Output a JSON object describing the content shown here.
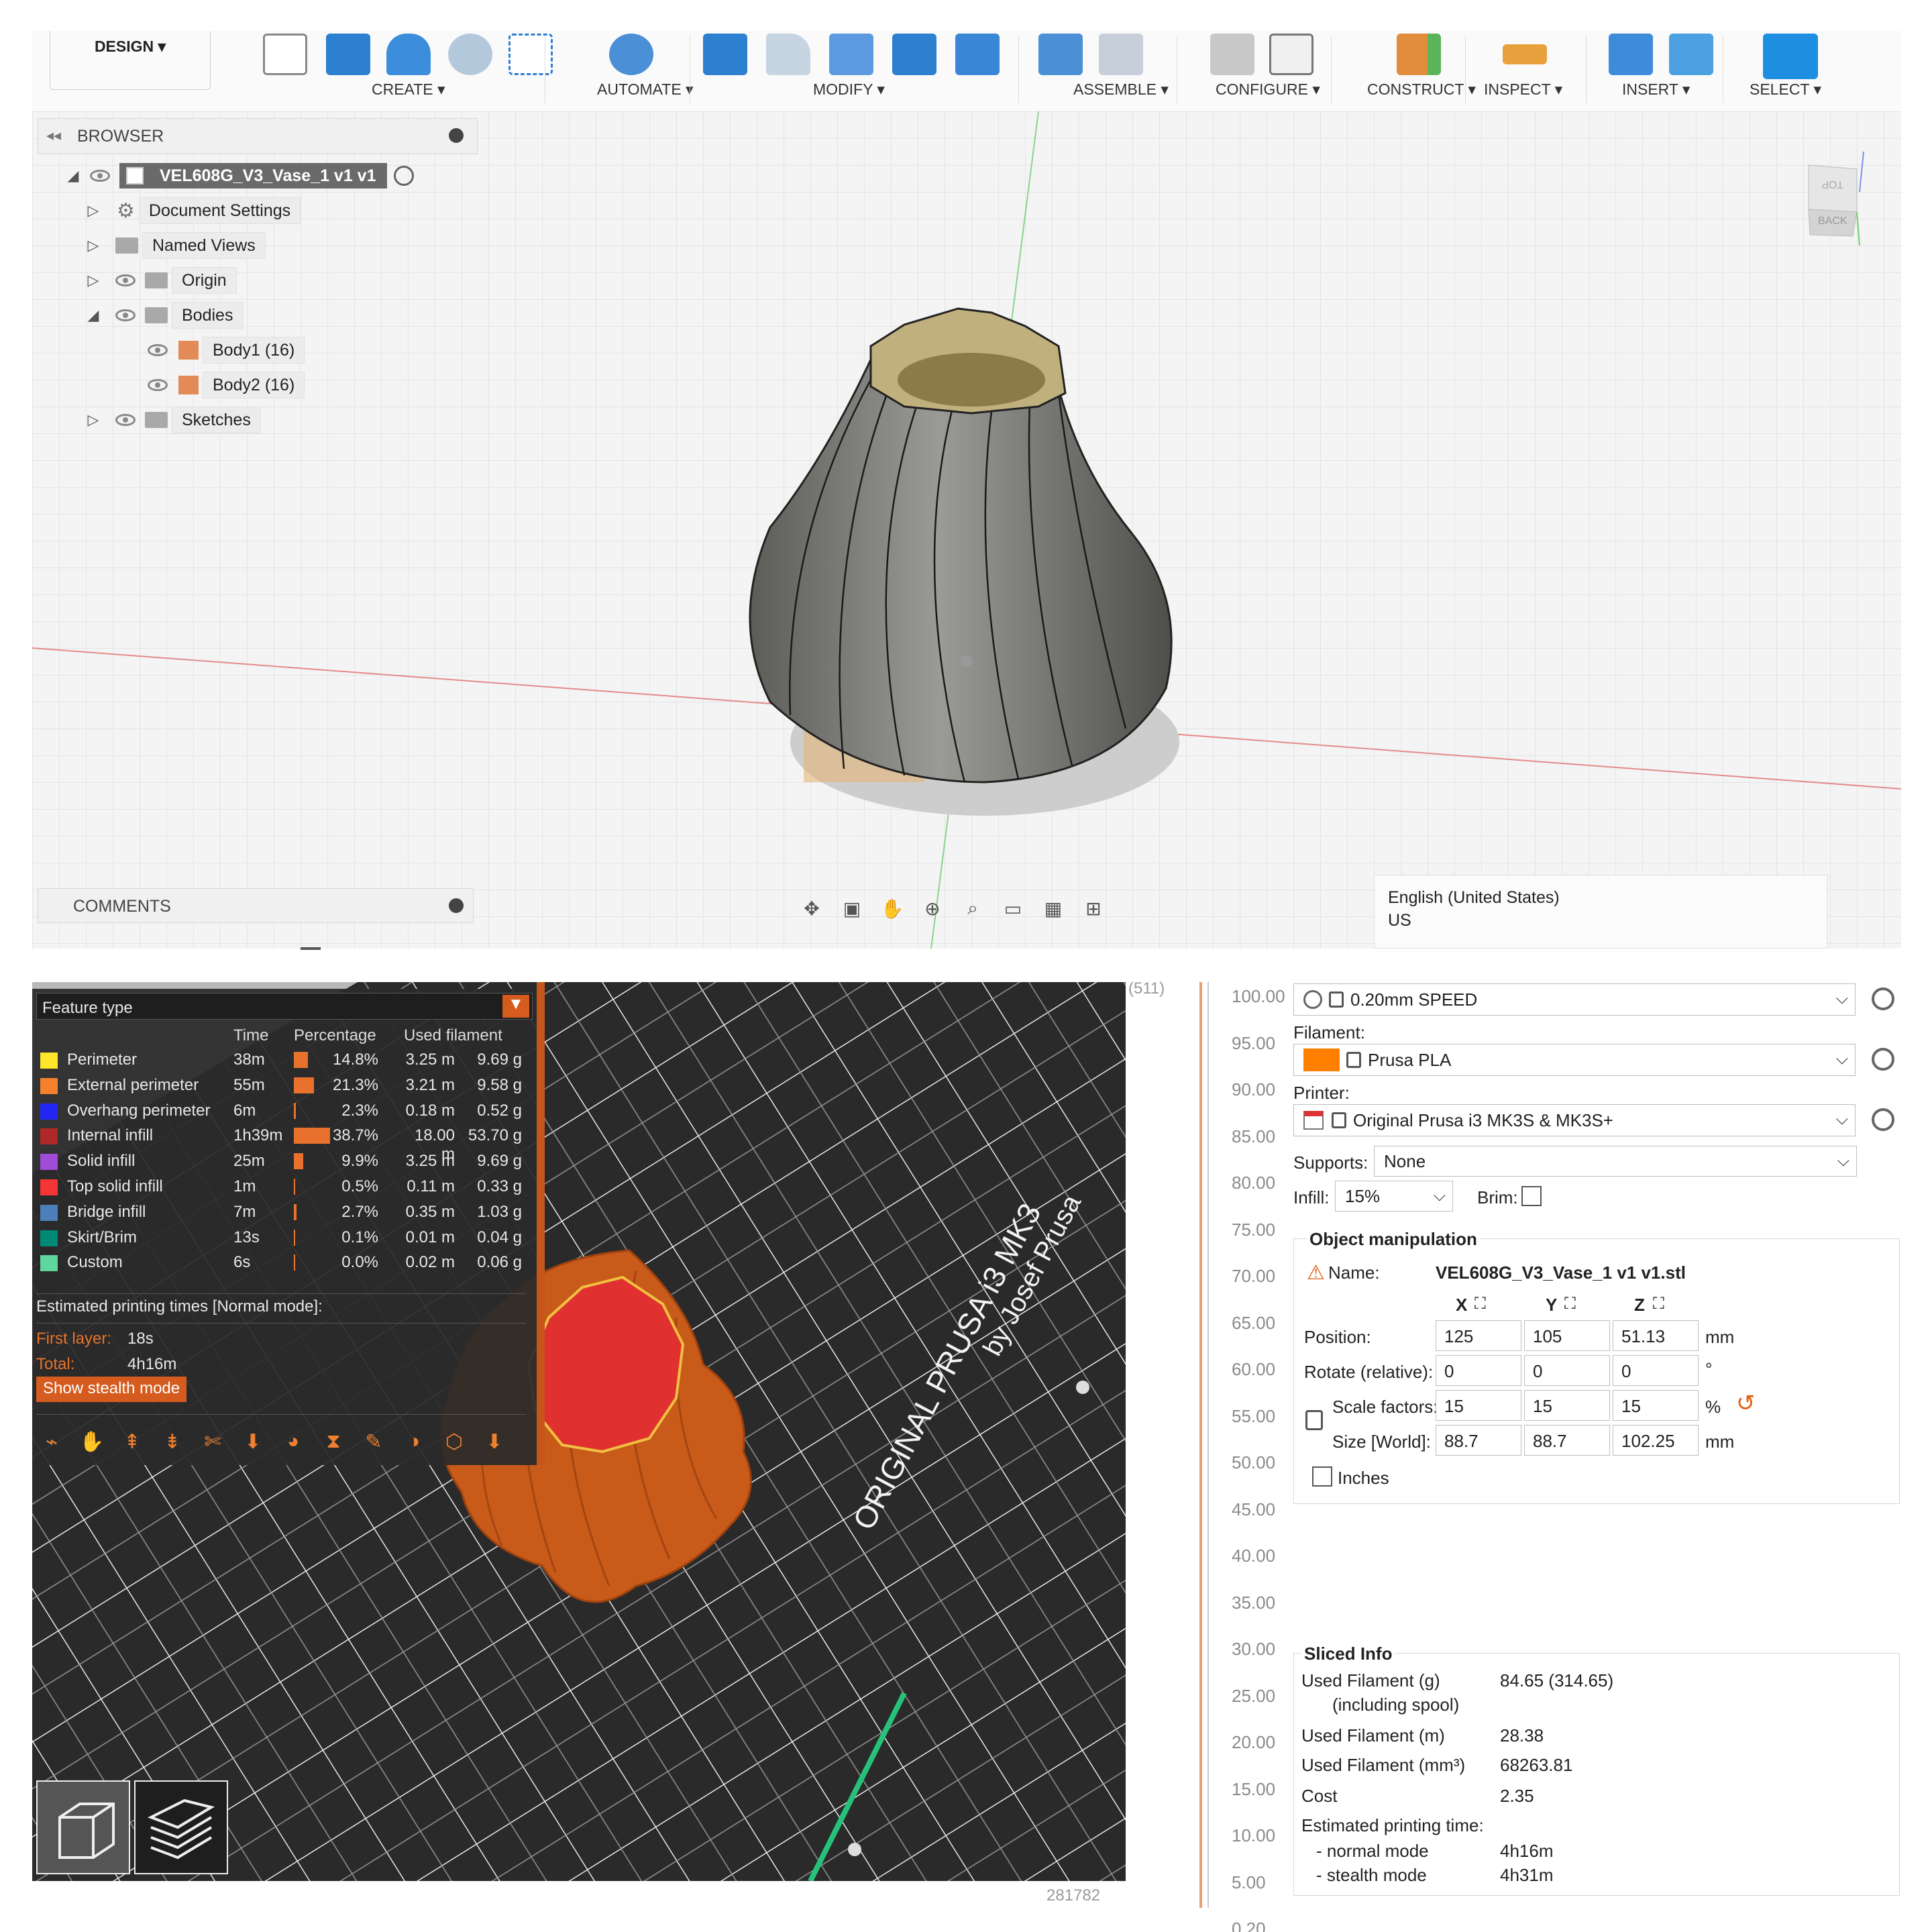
{
  "fusion": {
    "workspace": "DESIGN ▾",
    "toolbar_groups": [
      {
        "label": "CREATE ▾"
      },
      {
        "label": "AUTOMATE ▾"
      },
      {
        "label": "MODIFY ▾"
      },
      {
        "label": "ASSEMBLE ▾"
      },
      {
        "label": "CONFIGURE ▾"
      },
      {
        "label": "CONSTRUCT ▾"
      },
      {
        "label": "INSPECT ▾"
      },
      {
        "label": "INSERT ▾"
      },
      {
        "label": "SELECT ▾"
      }
    ],
    "browser": {
      "title": "BROWSER",
      "root": "VEL608G_V3_Vase_1 v1 v1",
      "items": [
        {
          "label": "Document Settings"
        },
        {
          "label": "Named Views"
        },
        {
          "label": "Origin"
        },
        {
          "label": "Bodies"
        },
        {
          "label": "Body1 (16)"
        },
        {
          "label": "Body2 (16)"
        },
        {
          "label": "Sketches"
        }
      ]
    },
    "comments": "COMMENTS",
    "view_cube": {
      "top": "TOP",
      "back": "BACK"
    },
    "language_tip": {
      "line1": "English (United States)",
      "line2": "US"
    }
  },
  "prusa": {
    "legend": {
      "title": "Feature type",
      "headers": {
        "time": "Time",
        "percentage": "Percentage",
        "used": "Used filament"
      },
      "rows": [
        {
          "name": "Perimeter",
          "color": "#ffe628",
          "time": "38m",
          "pct": "14.8%",
          "pct_val": 14.8,
          "m": "3.25 m",
          "g": "9.69 g"
        },
        {
          "name": "External perimeter",
          "color": "#f5812f",
          "time": "55m",
          "pct": "21.3%",
          "pct_val": 21.3,
          "m": "3.21 m",
          "g": "9.58 g"
        },
        {
          "name": "Overhang perimeter",
          "color": "#2226f5",
          "time": "6m",
          "pct": "2.3%",
          "pct_val": 2.3,
          "m": "0.18 m",
          "g": "0.52 g"
        },
        {
          "name": "Internal infill",
          "color": "#b02828",
          "time": "1h39m",
          "pct": "38.7%",
          "pct_val": 38.7,
          "m": "18.00 m",
          "g": "53.70 g"
        },
        {
          "name": "Solid infill",
          "color": "#a04cd9",
          "time": "25m",
          "pct": "9.9%",
          "pct_val": 9.9,
          "m": "3.25 m",
          "g": "9.69 g"
        },
        {
          "name": "Top solid infill",
          "color": "#f53535",
          "time": "1m",
          "pct": "0.5%",
          "pct_val": 0.5,
          "m": "0.11 m",
          "g": "0.33 g"
        },
        {
          "name": "Bridge infill",
          "color": "#4d80ba",
          "time": "7m",
          "pct": "2.7%",
          "pct_val": 2.7,
          "m": "0.35 m",
          "g": "1.03 g"
        },
        {
          "name": "Skirt/Brim",
          "color": "#008a75",
          "time": "13s",
          "pct": "0.1%",
          "pct_val": 0.1,
          "m": "0.01 m",
          "g": "0.04 g"
        },
        {
          "name": "Custom",
          "color": "#5ed69d",
          "time": "6s",
          "pct": "0.0%",
          "pct_val": 0.0,
          "m": "0.02 m",
          "g": "0.06 g"
        }
      ],
      "estimated_title": "Estimated printing times [Normal mode]:",
      "first_layer_label": "First layer:",
      "first_layer": "18s",
      "total_label": "Total:",
      "total": "4h16m",
      "stealth_button": "Show stealth mode"
    },
    "bed_text_1": "ORIGINAL PRUSA i3 MK3",
    "bed_text_2": "by Josef Prusa",
    "layer_top": "(511)",
    "move_count": "281782",
    "ruler": [
      "100.00",
      "95.00",
      "90.00",
      "85.00",
      "80.00",
      "75.00",
      "70.00",
      "65.00",
      "60.00",
      "55.00",
      "50.00",
      "45.00",
      "40.00",
      "35.00",
      "30.00",
      "25.00",
      "20.00",
      "15.00",
      "10.00",
      "5.00",
      "0.20"
    ],
    "print_settings": "0.20mm SPEED",
    "filament_label": "Filament:",
    "filament": "Prusa PLA",
    "filament_color": "#ff7f00",
    "printer_label": "Printer:",
    "printer": "Original Prusa i3 MK3S & MK3S+",
    "supports_label": "Supports:",
    "supports": "None",
    "infill_label": "Infill:",
    "infill": "15%",
    "brim_label": "Brim:",
    "object_manipulation": {
      "title": "Object manipulation",
      "name_label": "Name:",
      "name": "VEL608G_V3_Vase_1 v1 v1.stl",
      "axes": [
        "X",
        "Y",
        "Z"
      ],
      "position_label": "Position:",
      "position": [
        "125",
        "105",
        "51.13"
      ],
      "position_unit": "mm",
      "rotate_label": "Rotate (relative):",
      "rotate": [
        "0",
        "0",
        "0"
      ],
      "rotate_unit": "°",
      "scale_label": "Scale factors:",
      "scale": [
        "15",
        "15",
        "15"
      ],
      "scale_unit": "%",
      "size_label": "Size [World]:",
      "size": [
        "88.7",
        "88.7",
        "102.25"
      ],
      "size_unit": "mm",
      "inches_label": "Inches"
    },
    "sliced_info": {
      "title": "Sliced Info",
      "used_g_label": "Used Filament (g)",
      "used_g_sub": "(including spool)",
      "used_g": "84.65 (314.65)",
      "used_m_label": "Used Filament (m)",
      "used_m": "28.38",
      "used_mm3_label": "Used Filament (mm³)",
      "used_mm3": "68263.81",
      "cost_label": "Cost",
      "cost": "2.35",
      "est_label": "Estimated printing time:",
      "normal_label": "- normal mode",
      "normal": "4h16m",
      "stealth_label": "- stealth mode",
      "stealth": "4h31m"
    }
  }
}
